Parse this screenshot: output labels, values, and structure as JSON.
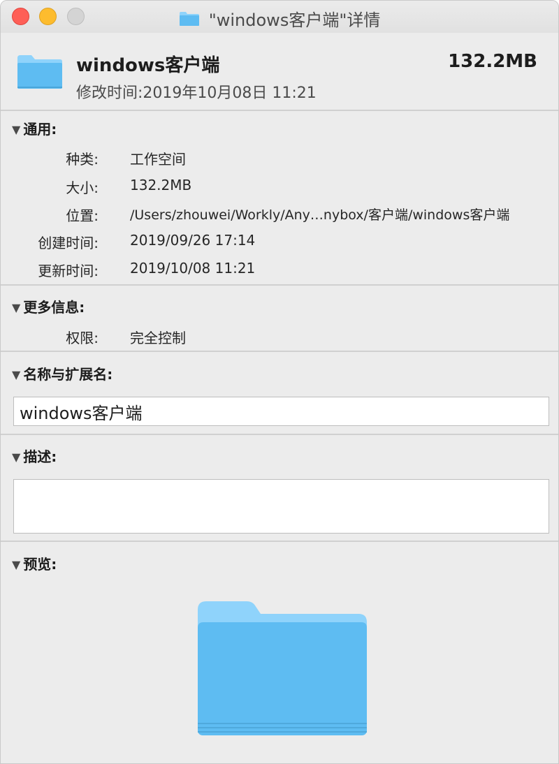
{
  "window": {
    "title": "\"windows客户端\"详情"
  },
  "header": {
    "name": "windows客户端",
    "size": "132.2MB",
    "modified": "修改时间:2019年10月08日  11:21"
  },
  "general": {
    "heading": "通用:",
    "rows": [
      {
        "label": "种类:",
        "value": "工作空间"
      },
      {
        "label": "大小:",
        "value": "132.2MB"
      },
      {
        "label": "位置:",
        "value": "/Users/zhouwei/Workly/Any…nybox/客户端/windows客户端"
      },
      {
        "label": "创建时间:",
        "value": "2019/09/26  17:14"
      },
      {
        "label": "更新时间:",
        "value": "2019/10/08  11:21"
      }
    ]
  },
  "more_info": {
    "heading": "更多信息:",
    "rows": [
      {
        "label": "权限:",
        "value": "完全控制"
      }
    ]
  },
  "name_ext": {
    "heading": "名称与扩展名:",
    "value": "windows客户端"
  },
  "description": {
    "heading": "描述:",
    "value": ""
  },
  "preview": {
    "heading": "预览:"
  },
  "colors": {
    "folder_light": "#8fd3fb",
    "folder_main": "#5ebcf2",
    "close": "#fe5f57",
    "minimize": "#fdbc2e",
    "zoom_disabled": "#d4d4d4"
  },
  "icons": [
    "close-button",
    "minimize-button",
    "zoom-button",
    "folder-icon",
    "disclosure-triangle-icon"
  ]
}
